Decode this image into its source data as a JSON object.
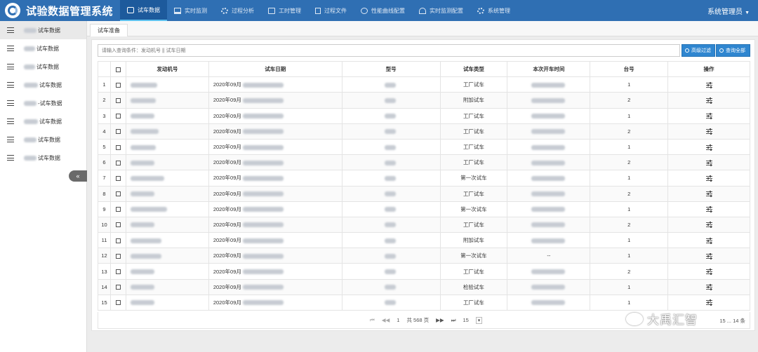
{
  "header": {
    "title": "试验数据管理系统",
    "nav": [
      {
        "label": "试车数据",
        "icon": "database-icon",
        "active": true
      },
      {
        "label": "实时监测",
        "icon": "monitor-icon",
        "active": false
      },
      {
        "label": "过程分析",
        "icon": "analysis-icon",
        "active": false
      },
      {
        "label": "工时管理",
        "icon": "briefcase-icon",
        "active": false
      },
      {
        "label": "过程文件",
        "icon": "file-icon",
        "active": false
      },
      {
        "label": "性能曲线配置",
        "icon": "gear-icon",
        "active": false
      },
      {
        "label": "实时监测配置",
        "icon": "gauge-icon",
        "active": false
      },
      {
        "label": "系统管理",
        "icon": "settings-icon",
        "active": false
      }
    ],
    "user": "系统管理员"
  },
  "sidebar": {
    "items": [
      {
        "label": "试车数据"
      },
      {
        "label": "试车数据"
      },
      {
        "label": "试车数据"
      },
      {
        "label": "试车数据"
      },
      {
        "label": "-试车数据"
      },
      {
        "label": "试车数据"
      },
      {
        "label": "试车数据"
      },
      {
        "label": "试车数据"
      }
    ],
    "collapse_label": "«"
  },
  "tab": {
    "label": "试车准备"
  },
  "search": {
    "placeholder": "请输入查询条件：发动机号 || 试车日期",
    "filter_label": "高级过滤",
    "all_label": "查询全部"
  },
  "table": {
    "headers": [
      "发动机号",
      "试车日期",
      "型号",
      "试车类型",
      "本次开车时间",
      "台号",
      "操作"
    ],
    "rows": [
      {
        "n": "1",
        "date": "2020年09月",
        "type": "工厂试车",
        "stand": "1"
      },
      {
        "n": "2",
        "date": "2020年09月",
        "type": "附加试车",
        "stand": "2"
      },
      {
        "n": "3",
        "date": "2020年09月",
        "type": "工厂试车",
        "stand": "1"
      },
      {
        "n": "4",
        "date": "2020年09月",
        "type": "工厂试车",
        "stand": "2"
      },
      {
        "n": "5",
        "date": "2020年09月",
        "type": "工厂试车",
        "stand": "1"
      },
      {
        "n": "6",
        "date": "2020年09月",
        "type": "工厂试车",
        "stand": "2"
      },
      {
        "n": "7",
        "date": "2020年09月",
        "type": "第一次试车",
        "stand": "1"
      },
      {
        "n": "8",
        "date": "2020年09月",
        "type": "工厂试车",
        "stand": "2"
      },
      {
        "n": "9",
        "date": "2020年09月",
        "type": "第一次试车",
        "stand": "1"
      },
      {
        "n": "10",
        "date": "2020年09月",
        "type": "工厂试车",
        "stand": "2"
      },
      {
        "n": "11",
        "date": "2020年09月",
        "type": "附加试车",
        "stand": "1"
      },
      {
        "n": "12",
        "date": "2020年09月",
        "type": "第一次试车",
        "stand": "1",
        "time": "--"
      },
      {
        "n": "13",
        "date": "2020年09月",
        "type": "工厂试车",
        "stand": "2"
      },
      {
        "n": "14",
        "date": "2020年09月",
        "type": "检验试车",
        "stand": "1"
      },
      {
        "n": "15",
        "date": "2020年09月",
        "type": "工厂试车",
        "stand": "1"
      }
    ]
  },
  "pager": {
    "current": "1",
    "total": "共 568 页",
    "size": "15",
    "summary": "15 ... 14 条"
  },
  "watermark": "大禹汇智"
}
